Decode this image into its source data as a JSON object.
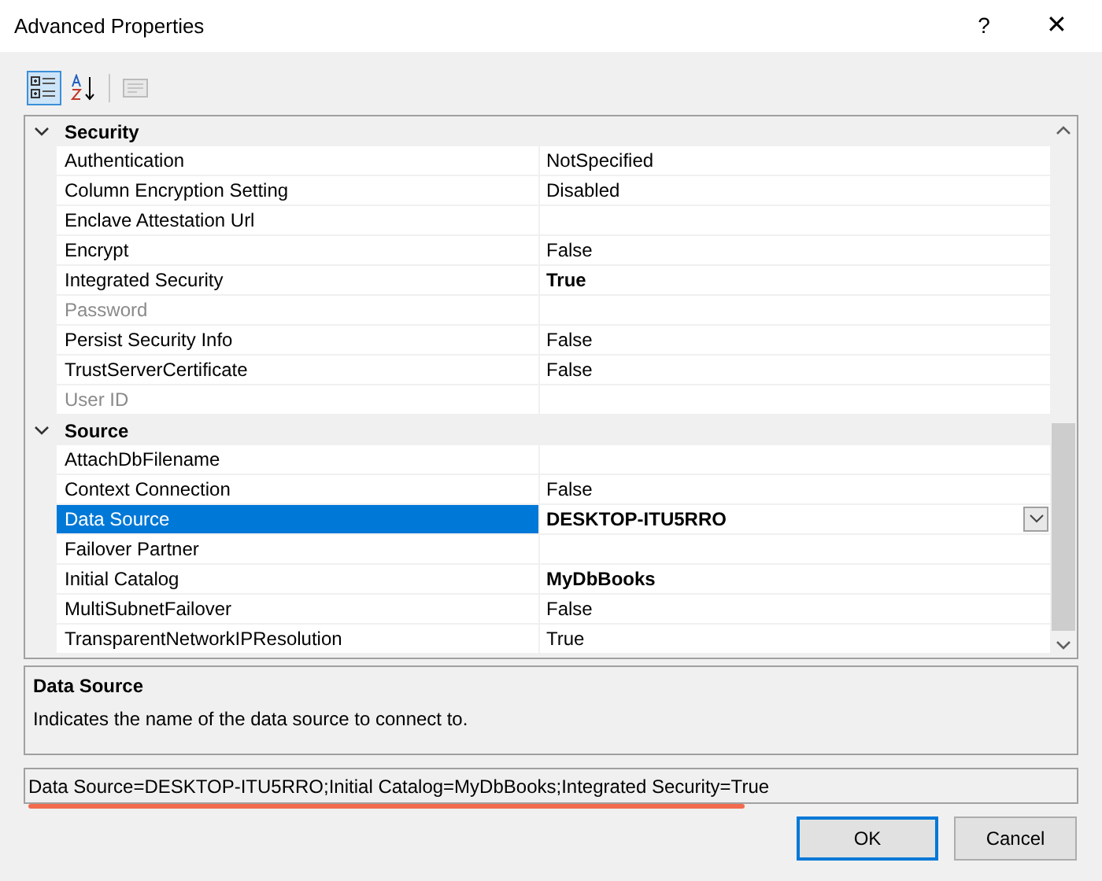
{
  "window": {
    "title": "Advanced Properties",
    "help": "?",
    "close": "✕"
  },
  "toolbar": [
    {
      "kind": "categorized",
      "selected": true
    },
    {
      "kind": "alphabetical",
      "selected": false
    },
    {
      "kind": "pages",
      "selected": false,
      "disabled": true
    }
  ],
  "grid": {
    "categories": [
      {
        "name": "Security",
        "expanded": true,
        "properties": [
          {
            "name": "Authentication",
            "value": "NotSpecified",
            "bold": false,
            "disabled": false,
            "selected": false
          },
          {
            "name": "Column Encryption Setting",
            "value": "Disabled",
            "bold": false,
            "disabled": false,
            "selected": false
          },
          {
            "name": "Enclave Attestation Url",
            "disabled": false,
            "selected": false
          },
          {
            "name": "Encrypt",
            "value": "False",
            "bold": false,
            "disabled": false,
            "selected": false
          },
          {
            "name": "Integrated Security",
            "value": "True",
            "bold": true,
            "disabled": false,
            "selected": false
          },
          {
            "name": "Password",
            "disabled": true,
            "selected": false
          },
          {
            "name": "Persist Security Info",
            "value": "False",
            "bold": false,
            "disabled": false,
            "selected": false
          },
          {
            "name": "TrustServerCertificate",
            "value": "False",
            "bold": false,
            "disabled": false,
            "selected": false
          },
          {
            "name": "User ID",
            "disabled": true,
            "selected": false
          }
        ]
      },
      {
        "name": "Source",
        "expanded": true,
        "properties": [
          {
            "name": "AttachDbFilename",
            "disabled": false,
            "selected": false
          },
          {
            "name": "Context Connection",
            "value": "False",
            "bold": false,
            "disabled": false,
            "selected": false
          },
          {
            "name": "Data Source",
            "value": "DESKTOP-ITU5RRO",
            "bold": true,
            "disabled": false,
            "selected": true
          },
          {
            "name": "Failover Partner",
            "disabled": false,
            "selected": false
          },
          {
            "name": "Initial Catalog",
            "value": "MyDbBooks",
            "bold": true,
            "disabled": false,
            "selected": false
          },
          {
            "name": "MultiSubnetFailover",
            "value": "False",
            "bold": false,
            "disabled": false,
            "selected": false
          },
          {
            "name": "TransparentNetworkIPResolution",
            "value": "True",
            "bold": false,
            "disabled": false,
            "selected": false
          }
        ]
      }
    ]
  },
  "description": {
    "title": "Data Source",
    "text": "Indicates the name of the data source to connect to."
  },
  "connection_string": "Data Source=DESKTOP-ITU5RRO;Initial Catalog=MyDbBooks;Integrated Security=True",
  "buttons": [
    {
      "label": "OK",
      "default": true
    },
    {
      "label": "Cancel",
      "default": false
    }
  ]
}
